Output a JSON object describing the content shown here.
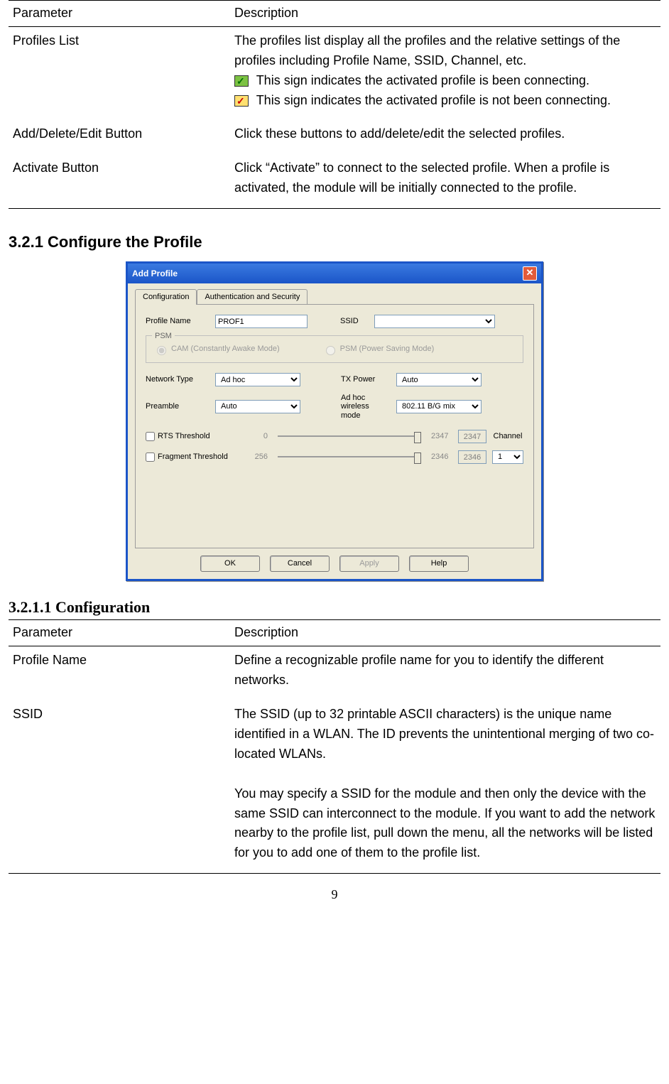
{
  "table1": {
    "header": {
      "param": "Parameter",
      "desc": "Description"
    },
    "rows": [
      {
        "param": "Profiles List",
        "desc_line1": "The profiles list display all the profiles and the relative settings of the profiles including Profile Name, SSID, Channel, etc.",
        "icon1_text": "This sign indicates the activated profile is been connecting.",
        "icon2_text": "This sign indicates the activated profile is not been connecting."
      },
      {
        "param": "Add/Delete/Edit Button",
        "desc": "Click these buttons to add/delete/edit the selected profiles."
      },
      {
        "param": "Activate Button",
        "desc": "Click “Activate” to connect to the selected profile. When a profile is activated, the module will be initially connected to the profile."
      }
    ]
  },
  "section321": "3.2.1   Configure the Profile",
  "dialog": {
    "title": "Add Profile",
    "tabs": [
      "Configuration",
      "Authentication and Security"
    ],
    "profile_name_label": "Profile Name",
    "profile_name_value": "PROF1",
    "ssid_label": "SSID",
    "group_psm": "PSM",
    "cam_label": "CAM (Constantly Awake Mode)",
    "psm_label": "PSM (Power Saving Mode)",
    "network_type_label": "Network Type",
    "network_type_value": "Ad hoc",
    "txpower_label": "TX Power",
    "txpower_value": "Auto",
    "preamble_label": "Preamble",
    "preamble_value": "Auto",
    "adhoc_mode_label": "Ad hoc wireless mode",
    "adhoc_mode_value": "802.11 B/G mix",
    "rts_label": "RTS Threshold",
    "rts_min": "0",
    "rts_max": "2347",
    "rts_val": "2347",
    "frag_label": "Fragment Threshold",
    "frag_min": "256",
    "frag_max": "2346",
    "frag_val": "2346",
    "channel_label": "Channel",
    "channel_value": "1",
    "buttons": {
      "ok": "OK",
      "cancel": "Cancel",
      "apply": "Apply",
      "help": "Help"
    }
  },
  "subsection": "3.2.1.1    Configuration",
  "table2": {
    "header": {
      "param": "Parameter",
      "desc": "Description"
    },
    "rows": [
      {
        "param": "Profile Name",
        "desc": "Define a recognizable profile name for you to identify the different networks."
      },
      {
        "param": "SSID",
        "desc1": "The SSID (up to 32 printable ASCII characters) is the unique name identified in a WLAN. The ID prevents the unintentional merging of two co-located WLANs.",
        "desc2": "You may specify a SSID for the module and then only the device with the same SSID can interconnect to the module. If you want to add the network nearby to the profile list, pull down the menu, all the networks will be listed for you to add one of them to the profile list."
      }
    ]
  },
  "page_number": "9"
}
